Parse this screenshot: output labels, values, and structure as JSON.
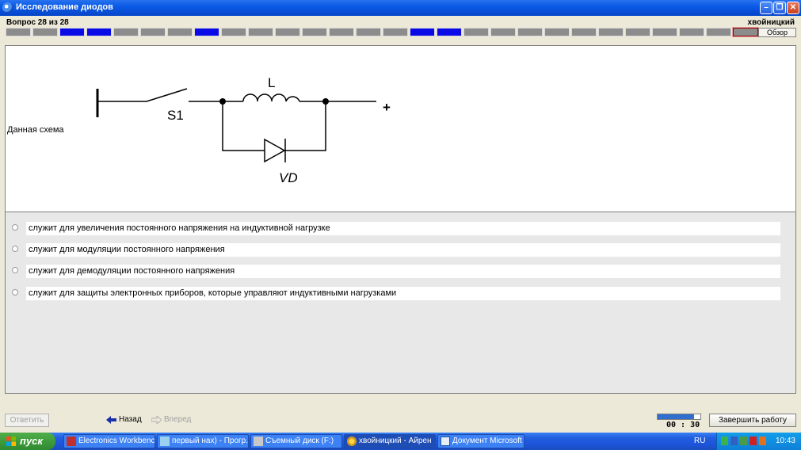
{
  "window": {
    "title": "Исследование диодов"
  },
  "header": {
    "question_counter": "Вопрос 28 из 28",
    "user": "хвойницкий",
    "review_label": "Обзор",
    "cells": [
      "n",
      "n",
      "a",
      "a",
      "n",
      "n",
      "n",
      "a",
      "n",
      "n",
      "n",
      "n",
      "n",
      "n",
      "n",
      "a",
      "a",
      "n",
      "n",
      "n",
      "n",
      "n",
      "n",
      "n",
      "n",
      "n",
      "n",
      "c"
    ]
  },
  "question": {
    "text": "Данная схема",
    "schematic": {
      "inductor": "L",
      "switch": "S1",
      "diode": "VD",
      "terminal": "+"
    }
  },
  "answers": [
    "служит для увеличения постоянного напряжения на индуктивной нагрузке",
    "служит для модуляции постоянного напряжения",
    "служит для демодуляции постоянного напряжения",
    "служит для защиты электронных приборов, которые управляют индуктивными нагрузками"
  ],
  "footer": {
    "answer_label": "Ответить",
    "back_label": "Назад",
    "forward_label": "Вперед",
    "timer": "00 : 30",
    "timer_fraction": 0.85,
    "finish_label": "Завершить работу"
  },
  "taskbar": {
    "start_label": "пуск",
    "tasks": [
      "Electronics Workbenc...",
      "первый нах) - Прогр...",
      "Съемный диск (F:)",
      "хвойницкий - Айрен",
      "Документ Microsoft ..."
    ],
    "language": "RU",
    "clock": "10:43"
  },
  "colors": {
    "answered": "#0a0ae6",
    "unanswered": "#8c8c8c",
    "titlebar": "#0a5ae6",
    "taskbar": "#225ee0"
  }
}
